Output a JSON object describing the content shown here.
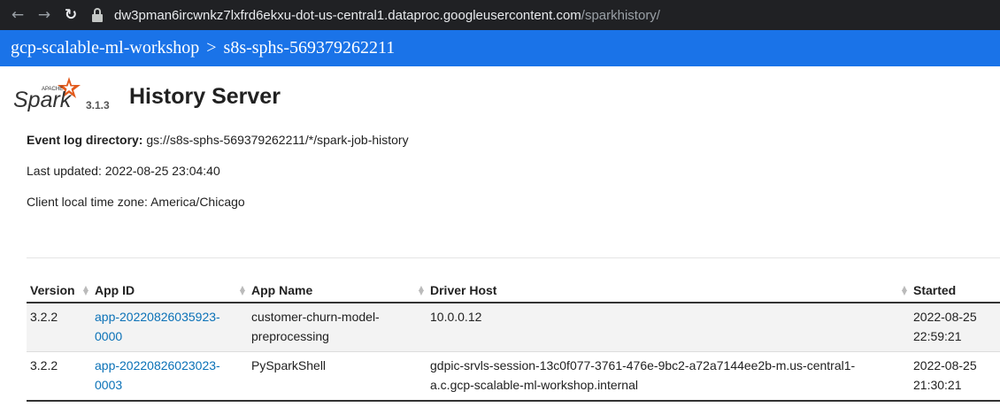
{
  "browser": {
    "url_host": "dw3pman6ircwnkz7lxfrd6ekxu-dot-us-central1.dataproc.googleusercontent.com",
    "url_path": "/sparkhistory/",
    "back_icon": "arrow-left-icon",
    "forward_icon": "arrow-right-icon",
    "reload_icon": "reload-icon"
  },
  "header": {
    "project": "gcp-scalable-ml-workshop",
    "separator": ">",
    "server": "s8s-sphs-569379262211",
    "background": "#1a73e8"
  },
  "brand": {
    "logo_small_text": "APACHE",
    "logo_text": "Spark",
    "version": "3.1.3",
    "title": "History Server",
    "accent": "#e25a1c"
  },
  "info": {
    "log_label": "Event log directory:",
    "log_value": "gs://s8s-sphs-569379262211/*/spark-job-history",
    "updated_label": "Last updated:",
    "updated_value": "2022-08-25 23:04:40",
    "tz_label": "Client local time zone:",
    "tz_value": "America/Chicago"
  },
  "table": {
    "columns": [
      "Version",
      "App ID",
      "App Name",
      "Driver Host",
      "Started"
    ],
    "rows": [
      {
        "version": "3.2.2",
        "app_id_line1": "app-20220826035923-",
        "app_id_line2": "0000",
        "app_name_line1": "customer-churn-model-",
        "app_name_line2": "preprocessing",
        "driver_line1": "10.0.0.12",
        "driver_line2": "",
        "started_line1": "2022-08-25",
        "started_line2": "22:59:21"
      },
      {
        "version": "3.2.2",
        "app_id_line1": "app-20220826023023-",
        "app_id_line2": "0003",
        "app_name_line1": "PySparkShell",
        "app_name_line2": "",
        "driver_line1": "gdpic-srvls-session-13c0f077-3761-476e-9bc2-a72a7144ee2b-m.us-central1-",
        "driver_line2": "a.c.gcp-scalable-ml-workshop.internal",
        "started_line1": "2022-08-25",
        "started_line2": "21:30:21"
      }
    ],
    "link_color": "#0a71b7"
  }
}
